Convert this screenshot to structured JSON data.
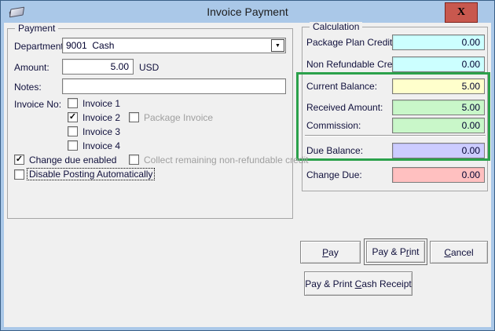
{
  "window": {
    "title": "Invoice Payment"
  },
  "icons": {
    "close": "X",
    "checkmark": "✓",
    "dropdown_arrow": "▼"
  },
  "colors": {
    "titlebar": "#aac8e8",
    "close_button": "#c8584e",
    "highlight_border": "#2ba14b"
  },
  "payment": {
    "legend": "Payment",
    "department": {
      "label": "Department:",
      "value": "9001  Cash"
    },
    "amount": {
      "label": "Amount:",
      "value": "5.00",
      "currency": "USD"
    },
    "notes": {
      "label": "Notes:",
      "value": ""
    },
    "invoice_no_label": "Invoice No:",
    "invoices": [
      {
        "label": "Invoice 1",
        "checked": false
      },
      {
        "label": "Invoice 2",
        "checked": true
      },
      {
        "label": "Invoice 3",
        "checked": false
      },
      {
        "label": "Invoice 4",
        "checked": false
      }
    ],
    "package_invoice": {
      "label": "Package Invoice",
      "checked": false,
      "disabled": true
    },
    "change_due_enabled": {
      "label": "Change due enabled",
      "checked": true
    },
    "collect_remaining": {
      "label": "Collect remaining non-refundable credit",
      "checked": false,
      "disabled": true
    },
    "disable_posting": {
      "label": "Disable Posting Automatically",
      "checked": false
    }
  },
  "calculation": {
    "legend": "Calculation",
    "rows": [
      {
        "label": "Package Plan Credit:",
        "value": "0.00",
        "bg": "#ccffff"
      },
      {
        "label": "Non Refundable Credit:",
        "value": "0.00",
        "bg": "#ccffff"
      },
      {
        "label": "Current Balance:",
        "value": "5.00",
        "bg": "#ffffcc"
      },
      {
        "label": "Received Amount:",
        "value": "5.00",
        "bg": "#c9f7c9"
      },
      {
        "label": "Commission:",
        "value": "0.00",
        "bg": "#c9f7c9"
      },
      {
        "label": "Due Balance:",
        "value": "0.00",
        "bg": "#ccccff"
      },
      {
        "label": "Change Due:",
        "value": "0.00",
        "bg": "#ffc0c0"
      }
    ]
  },
  "buttons": {
    "pay": {
      "pre": "",
      "mn": "P",
      "post": "ay"
    },
    "pay_print": {
      "pre": "Pay & P",
      "mn": "r",
      "post": "int"
    },
    "cancel": {
      "pre": "",
      "mn": "C",
      "post": "ancel"
    },
    "pay_print_cash": {
      "pre": "Pay & Print ",
      "mn": "C",
      "post": "ash Receipt"
    }
  }
}
